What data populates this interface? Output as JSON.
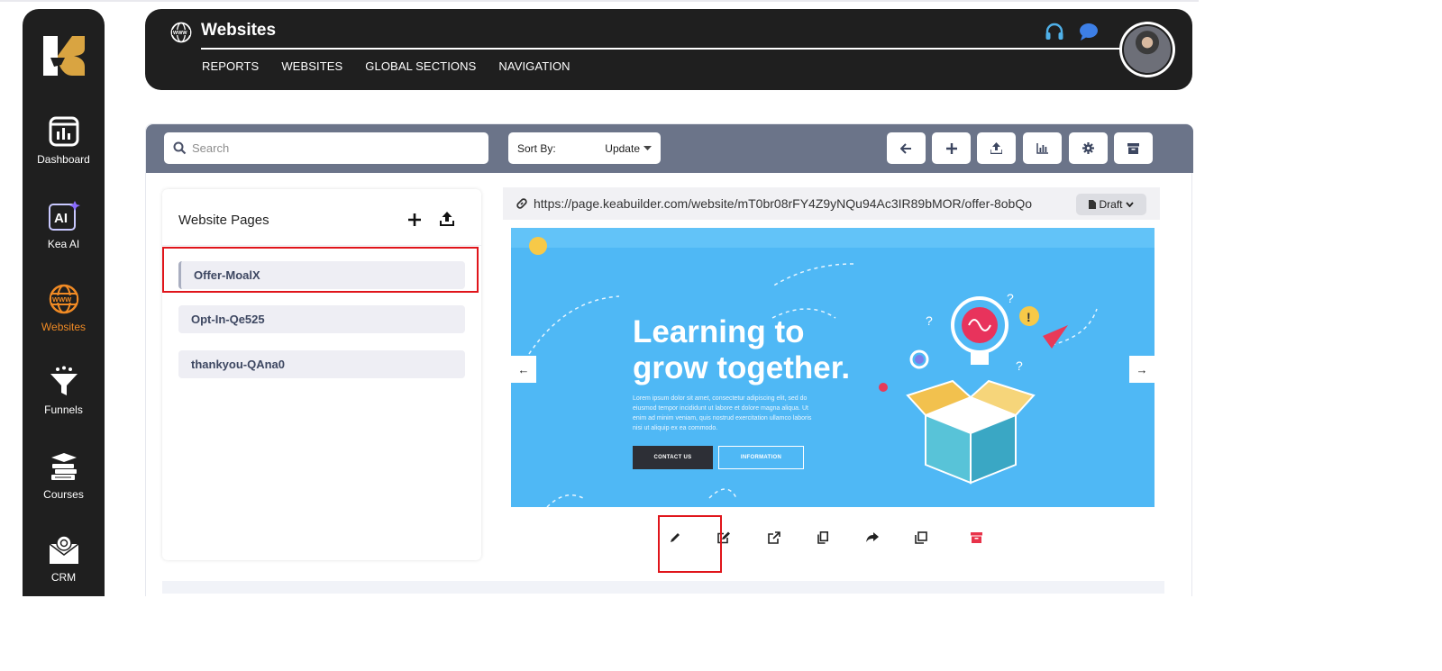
{
  "sidebar": {
    "items": [
      {
        "label": "Dashboard",
        "icon": "dashboard-icon"
      },
      {
        "label": "Kea AI",
        "icon": "ai-icon"
      },
      {
        "label": "Websites",
        "icon": "www-globe-icon",
        "active": true
      },
      {
        "label": "Funnels",
        "icon": "funnel-icon"
      },
      {
        "label": "Courses",
        "icon": "books-icon"
      },
      {
        "label": "CRM",
        "icon": "crm-mail-icon"
      }
    ]
  },
  "header": {
    "title": "Websites",
    "nav": [
      "REPORTS",
      "WEBSITES",
      "GLOBAL SECTIONS",
      "NAVIGATION"
    ]
  },
  "toolbar": {
    "search_placeholder": "Search",
    "sort_label": "Sort By:",
    "sort_value": "Update",
    "buttons": [
      "back-arrow-icon",
      "plus-icon",
      "upload-icon",
      "chart-icon",
      "gear-icon",
      "archive-icon"
    ]
  },
  "pages_panel": {
    "title": "Website Pages",
    "items": [
      "Offer-MoalX",
      "Opt-In-Qe525",
      "thankyou-QAna0"
    ]
  },
  "preview": {
    "url": "https://page.keabuilder.com/website/mT0br08rFY4Z9yNQu94Ac3IR89bMOR/offer-8obQo",
    "status": "Draft",
    "headline_1": "Learning to",
    "headline_2": "grow together.",
    "body": "Lorem ipsum dolor sit amet, consectetur adipiscing elit, sed do eiusmod tempor incididunt ut labore et dolore magna aliqua. Ut enim ad minim veniam, quis nostrud exercitation ullamco laboris nisi ut aliquip ex ea commodo.",
    "cta_primary": "CONTACT US",
    "cta_secondary": "INFORMATION"
  },
  "actions": [
    "pencil-icon",
    "edit-square-icon",
    "external-link-icon",
    "copy-icon",
    "share-icon",
    "duplicate-icon",
    "archive-red-icon"
  ],
  "colors": {
    "dark": "#1f1f1f",
    "accent_orange": "#f08a24",
    "toolbar_gray": "#6b7489",
    "highlight_red": "#e0151b",
    "preview_blue": "#4fb8f5"
  }
}
